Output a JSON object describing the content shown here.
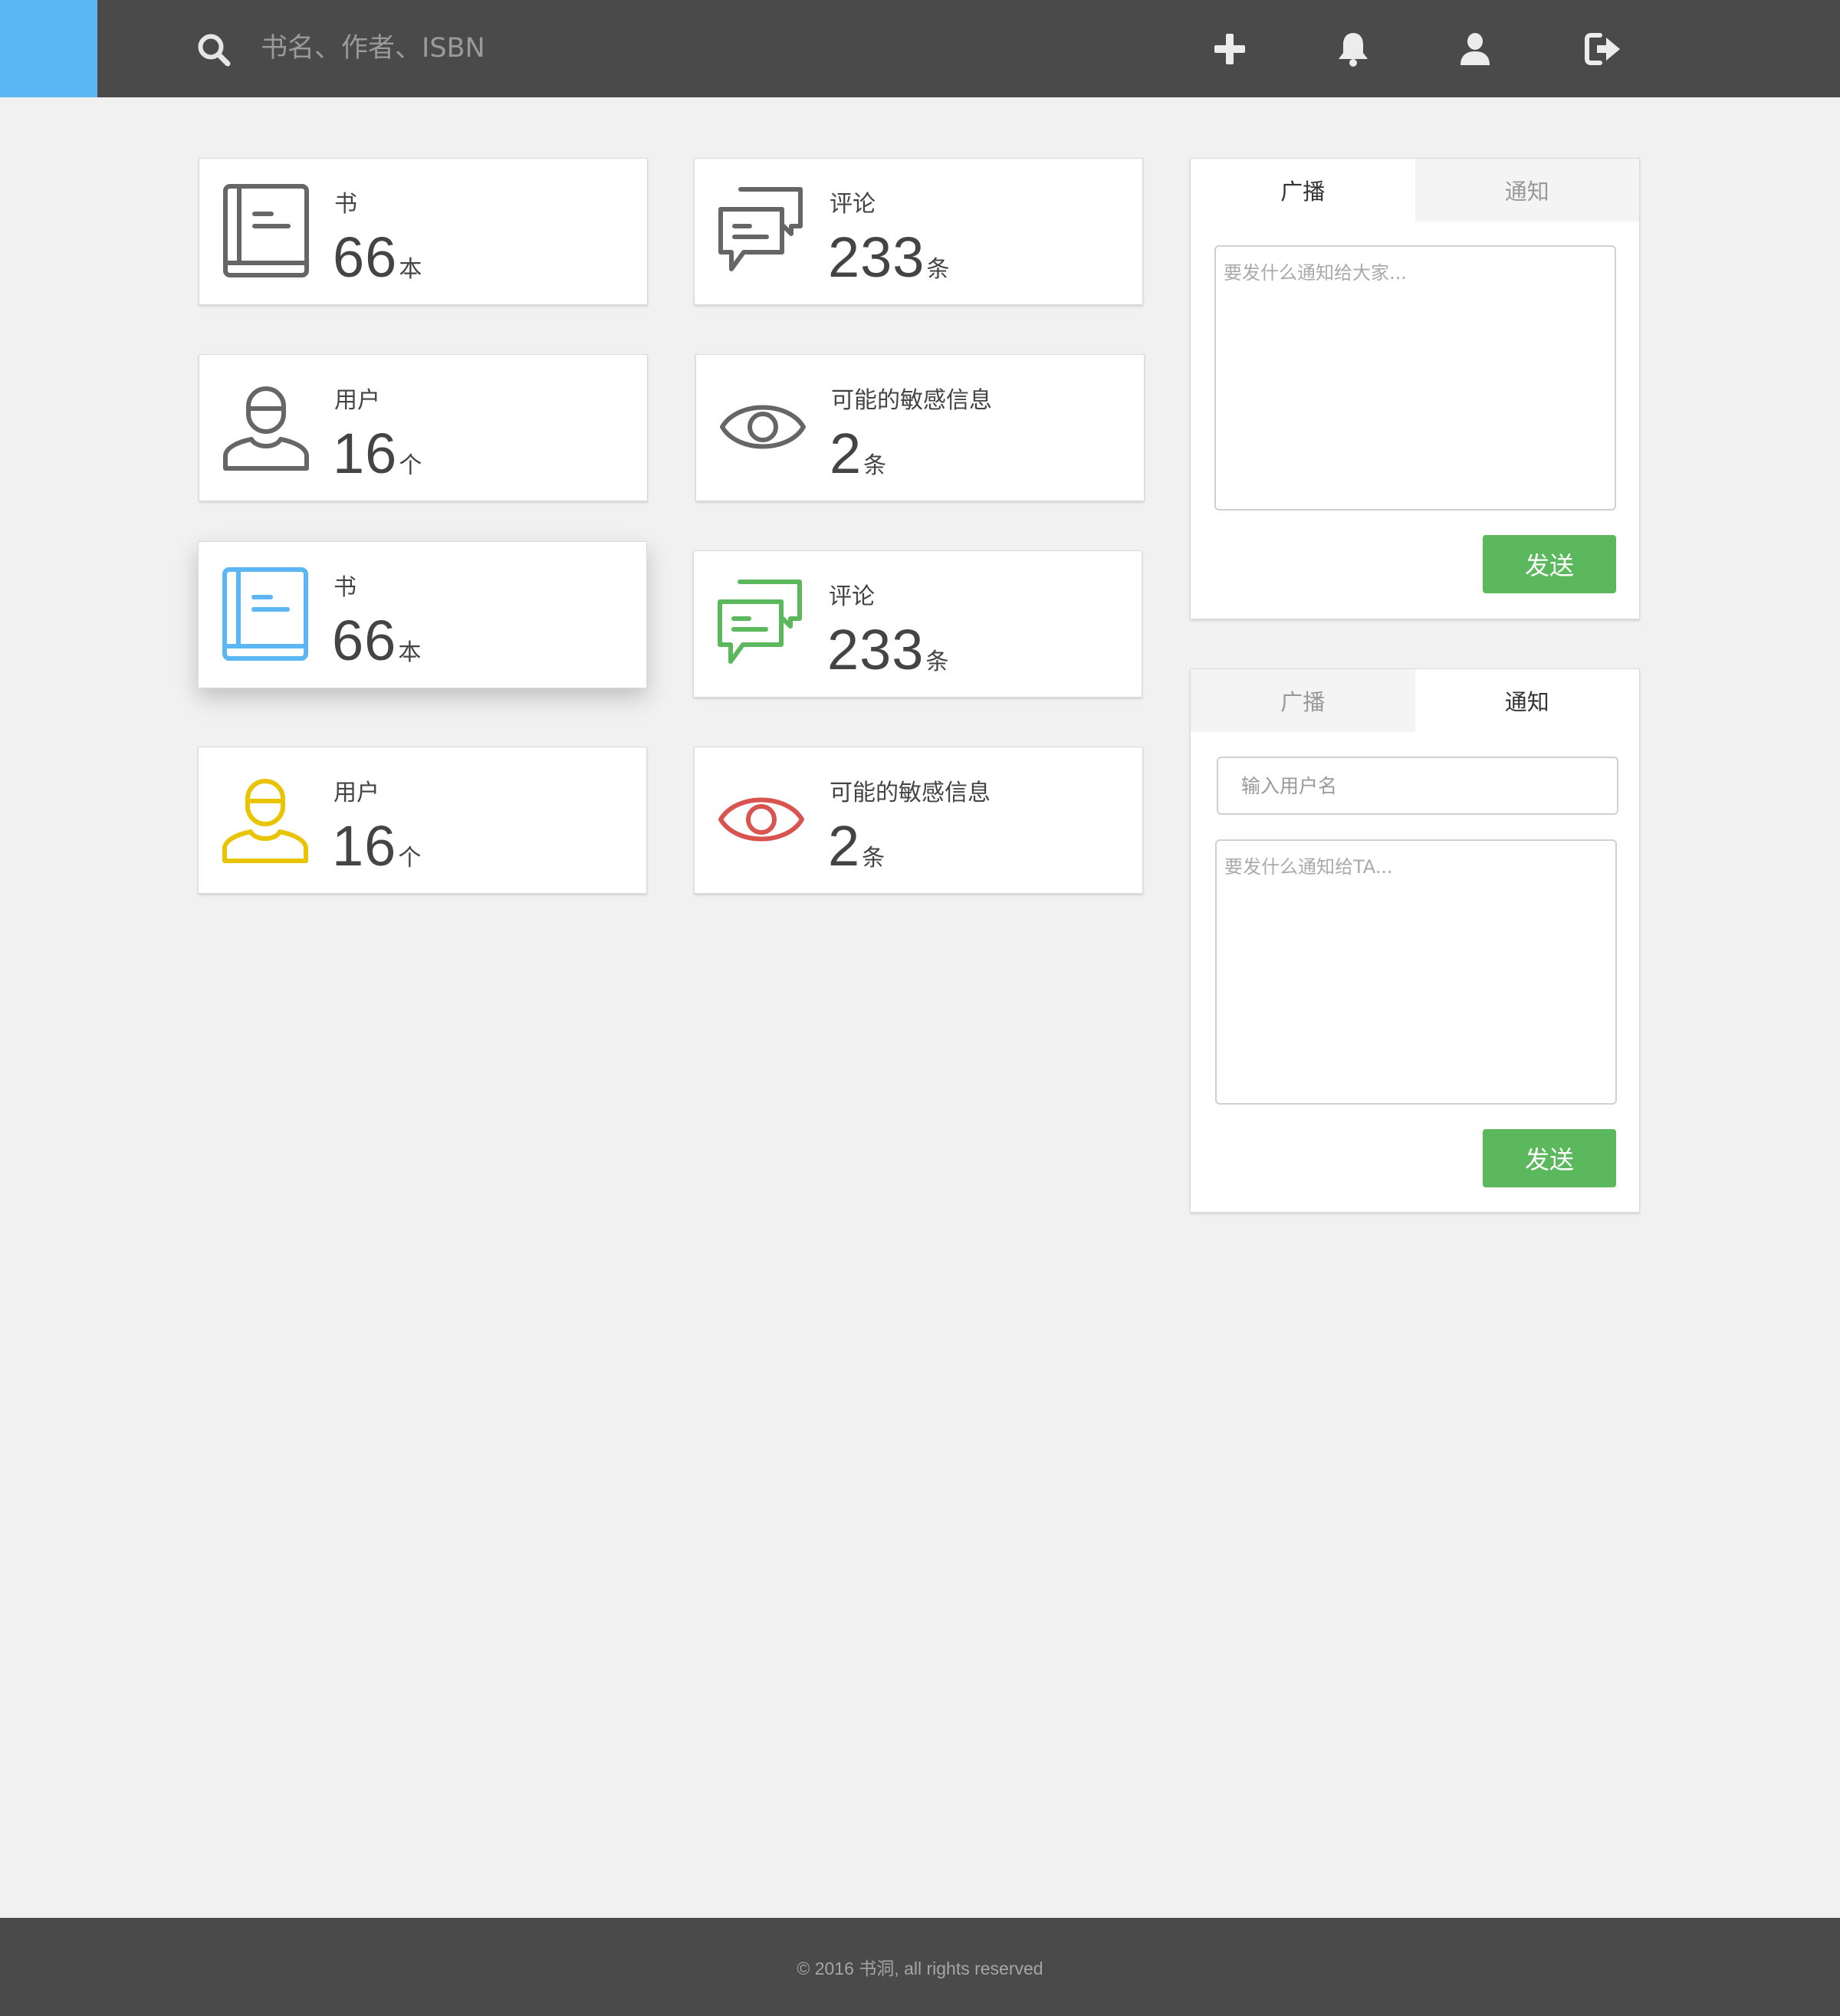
{
  "header": {
    "search_placeholder": "书名、作者、ISBN",
    "brand_color": "#5cb6f4",
    "icons": [
      "search-icon",
      "plus-icon",
      "bell-icon",
      "user-icon",
      "logout-icon"
    ]
  },
  "stats_gray": [
    {
      "label": "书",
      "value": "66",
      "unit": "本",
      "icon": "book-icon"
    },
    {
      "label": "评论",
      "value": "233",
      "unit": "条",
      "icon": "comments-icon"
    },
    {
      "label": "用户",
      "value": "16",
      "unit": "个",
      "icon": "user-icon"
    },
    {
      "label": "可能的敏感信息",
      "value": "2",
      "unit": "条",
      "icon": "eye-icon"
    }
  ],
  "stats_color": [
    {
      "label": "书",
      "value": "66",
      "unit": "本",
      "icon": "book-icon",
      "color": "#5cb6f4"
    },
    {
      "label": "评论",
      "value": "233",
      "unit": "条",
      "icon": "comments-icon",
      "color": "#5cb85c"
    },
    {
      "label": "用户",
      "value": "16",
      "unit": "个",
      "icon": "user-icon",
      "color": "#e8c500"
    },
    {
      "label": "可能的敏感信息",
      "value": "2",
      "unit": "条",
      "icon": "eye-icon",
      "color": "#d9534f"
    }
  ],
  "broadcast_panel": {
    "tabs": [
      "广播",
      "通知"
    ],
    "active_tab": "广播",
    "message_placeholder": "要发什么通知给大家...",
    "send_label": "发送"
  },
  "notify_panel": {
    "tabs": [
      "广播",
      "通知"
    ],
    "active_tab": "通知",
    "username_placeholder": "输入用户名",
    "message_placeholder": "要发什么通知给TA...",
    "send_label": "发送"
  },
  "colors": {
    "gray_icon": "#666666",
    "send_button": "#5cb85c",
    "header_bg": "#4a4a4a"
  },
  "footer": {
    "text": "© 2016 书洞, all rights reserved"
  }
}
